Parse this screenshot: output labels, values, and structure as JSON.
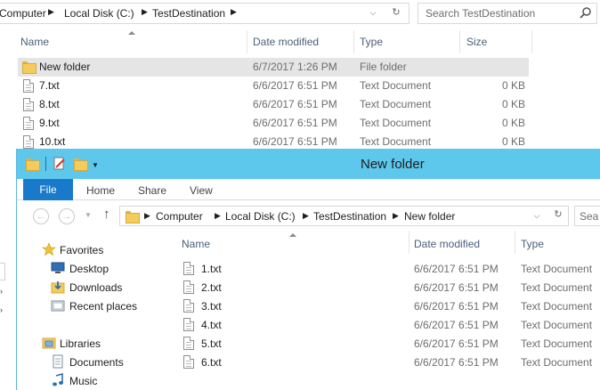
{
  "back_window": {
    "breadcrumb": [
      "Computer",
      "Local Disk (C:)",
      "TestDestination"
    ],
    "search_placeholder": "Search TestDestination",
    "columns": [
      "Name",
      "Date modified",
      "Type",
      "Size"
    ],
    "rows": [
      {
        "name": "New folder",
        "date": "6/7/2017 1:26 PM",
        "type": "File folder",
        "size": "",
        "icon": "folder-icon",
        "selected": true
      },
      {
        "name": "7.txt",
        "date": "6/6/2017 6:51 PM",
        "type": "Text Document",
        "size": "0 KB",
        "icon": "text-file-icon",
        "selected": false
      },
      {
        "name": "8.txt",
        "date": "6/6/2017 6:51 PM",
        "type": "Text Document",
        "size": "0 KB",
        "icon": "text-file-icon",
        "selected": false
      },
      {
        "name": "9.txt",
        "date": "6/6/2017 6:51 PM",
        "type": "Text Document",
        "size": "0 KB",
        "icon": "text-file-icon",
        "selected": false
      },
      {
        "name": "10.txt",
        "date": "6/6/2017 6:51 PM",
        "type": "Text Document",
        "size": "0 KB",
        "icon": "text-file-icon",
        "selected": false
      }
    ]
  },
  "front_window": {
    "title": "New folder",
    "ribbon_tabs": [
      "File",
      "Home",
      "Share",
      "View"
    ],
    "breadcrumb": [
      "Computer",
      "Local Disk (C:)",
      "TestDestination",
      "New folder"
    ],
    "search_placeholder": "Sea",
    "nav_pane": [
      {
        "label": "Favorites",
        "icon": "star-icon",
        "level": 0
      },
      {
        "label": "Desktop",
        "icon": "desktop-icon",
        "level": 1
      },
      {
        "label": "Downloads",
        "icon": "downloads-icon",
        "level": 1
      },
      {
        "label": "Recent places",
        "icon": "recent-places-icon",
        "level": 1
      },
      {
        "label": "Libraries",
        "icon": "libraries-icon",
        "level": 0
      },
      {
        "label": "Documents",
        "icon": "documents-icon",
        "level": 1
      },
      {
        "label": "Music",
        "icon": "music-icon",
        "level": 1
      }
    ],
    "columns": [
      "Name",
      "Date modified",
      "Type"
    ],
    "rows": [
      {
        "name": "1.txt",
        "date": "6/6/2017 6:51 PM",
        "type": "Text Document"
      },
      {
        "name": "2.txt",
        "date": "6/6/2017 6:51 PM",
        "type": "Text Document"
      },
      {
        "name": "3.txt",
        "date": "6/6/2017 6:51 PM",
        "type": "Text Document"
      },
      {
        "name": "4.txt",
        "date": "6/6/2017 6:51 PM",
        "type": "Text Document"
      },
      {
        "name": "5.txt",
        "date": "6/6/2017 6:51 PM",
        "type": "Text Document"
      },
      {
        "name": "6.txt",
        "date": "6/6/2017 6:51 PM",
        "type": "Text Document"
      }
    ]
  },
  "colors": {
    "titlebar": "#5ec7ec",
    "file_tab": "#1979ca",
    "column_header_text": "#4c607a",
    "selected_row": "#e5e5e5"
  }
}
